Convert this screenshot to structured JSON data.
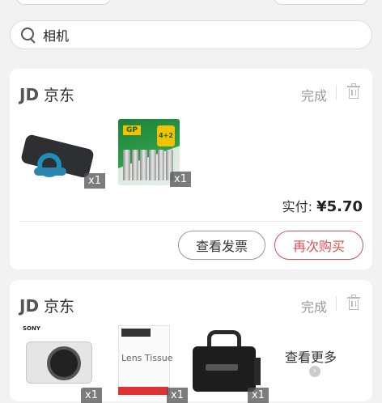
{
  "search": {
    "value": "相机"
  },
  "orders": [
    {
      "shop_logo": "JD",
      "shop_name": "京东",
      "status": "完成",
      "products": [
        {
          "name": "phone-stand",
          "qty": "x1"
        },
        {
          "name": "gp-batteries",
          "qty": "x1"
        }
      ],
      "total_label": "实付:",
      "total_amount": "¥5.70",
      "buttons": {
        "invoice": "查看发票",
        "rebuy": "再次购买"
      }
    },
    {
      "shop_logo": "JD",
      "shop_name": "京东",
      "status": "完成",
      "products": [
        {
          "name": "sony-camera",
          "qty": "x1",
          "brand": "SONY"
        },
        {
          "name": "lens-tissue",
          "qty": "x1",
          "label": "Lens Tissue"
        },
        {
          "name": "camera-bag",
          "qty": "x1"
        }
      ],
      "more_label": "查看更多"
    }
  ],
  "battery_pack_text": {
    "brand": "GP",
    "badge": "4+2"
  },
  "colors": {
    "accent_red": "#d94f4f",
    "background": "#f2f2f2"
  }
}
